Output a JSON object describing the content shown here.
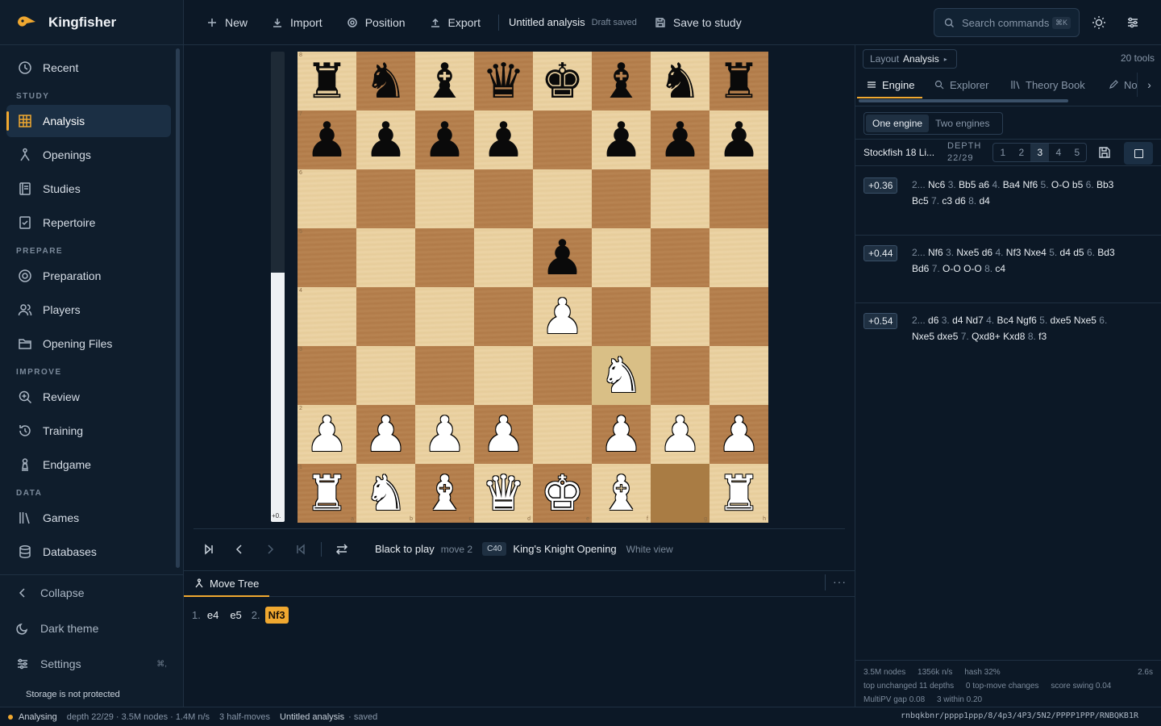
{
  "brand": {
    "name": "Kingfisher"
  },
  "sidebar": {
    "recent": {
      "label": "Recent",
      "icon": "clock-icon"
    },
    "sections": [
      {
        "title": "STUDY",
        "items": [
          {
            "label": "Analysis",
            "icon": "grid-icon",
            "active": true
          },
          {
            "label": "Openings",
            "icon": "branch-icon"
          },
          {
            "label": "Studies",
            "icon": "book-icon"
          },
          {
            "label": "Repertoire",
            "icon": "checklist-icon"
          }
        ]
      },
      {
        "title": "PREPARE",
        "items": [
          {
            "label": "Preparation",
            "icon": "target-icon"
          },
          {
            "label": "Players",
            "icon": "users-icon"
          },
          {
            "label": "Opening Files",
            "icon": "folder-icon"
          }
        ]
      },
      {
        "title": "IMPROVE",
        "items": [
          {
            "label": "Review",
            "icon": "zoom-icon"
          },
          {
            "label": "Training",
            "icon": "refresh-clock-icon"
          },
          {
            "label": "Endgame",
            "icon": "pawn-icon"
          }
        ]
      },
      {
        "title": "DATA",
        "items": [
          {
            "label": "Games",
            "icon": "library-icon"
          },
          {
            "label": "Databases",
            "icon": "database-icon"
          }
        ]
      }
    ],
    "collapse_label": "Collapse",
    "theme_label": "Dark theme",
    "settings_label": "Settings",
    "settings_kbd": "⌘,",
    "storage_note": "Storage is not protected"
  },
  "toolbar": {
    "new_label": "New",
    "import_label": "Import",
    "position_label": "Position",
    "export_label": "Export",
    "doc_title": "Untitled analysis",
    "draft_status": "Draft saved",
    "save_study_label": "Save to study",
    "search_placeholder": "Search commands",
    "search_kbd": "⌘K"
  },
  "eval_bar": {
    "white_fraction": 0.53,
    "label": "+0."
  },
  "board": {
    "orientation": "white",
    "fen": "rnbqkbnr/pppp1ppp/8/4p3/4P3/5N2/PPPP1PPP/RNBQKB1R",
    "highlight": [
      "g1",
      "f3"
    ],
    "ranks": [
      "8",
      "7",
      "6",
      "5",
      "4",
      "3",
      "2",
      "1"
    ],
    "files": [
      "a",
      "b",
      "c",
      "d",
      "e",
      "f",
      "g",
      "h"
    ]
  },
  "controls": {
    "to_play": "Black to play",
    "move": "move 2",
    "eco": "C40",
    "opening": "King's Knight Opening",
    "view": "White view"
  },
  "move_tree": {
    "tab_label": "Move Tree",
    "more": "···",
    "moves": [
      {
        "num": "1.",
        "white": "e4",
        "black": "e5"
      },
      {
        "num": "2.",
        "white": "Nf3",
        "current": "white"
      }
    ]
  },
  "right_panel": {
    "layout_prefix": "Layout",
    "layout_value": "Analysis",
    "tools_count": "20 tools",
    "tabs": [
      {
        "label": "Engine",
        "icon": "sliders-icon",
        "active": true
      },
      {
        "label": "Explorer",
        "icon": "search-icon"
      },
      {
        "label": "Theory Book",
        "icon": "library-icon"
      },
      {
        "label": "No",
        "icon": "pencil-icon"
      }
    ],
    "engine_modes": [
      "One engine",
      "Two engines"
    ],
    "engine_name": "Stockfish 18 Li...",
    "depth_label": "DEPTH",
    "depth_value": "22/29",
    "multipv": [
      "1",
      "2",
      "3",
      "4",
      "5"
    ],
    "multipv_selected": "3",
    "lines": [
      {
        "score": "+0.36",
        "text": [
          [
            "2...",
            "Nc6"
          ],
          [
            "3.",
            "Bb5"
          ],
          [
            "",
            "a6"
          ],
          [
            "4.",
            "Ba4"
          ],
          [
            "",
            "Nf6"
          ],
          [
            "5.",
            "O-O"
          ],
          [
            "",
            "b5"
          ],
          [
            "6.",
            "Bb3"
          ],
          [
            "",
            "Bc5"
          ],
          [
            "7.",
            "c3"
          ],
          [
            "",
            "d6"
          ],
          [
            "8.",
            "d4"
          ]
        ]
      },
      {
        "score": "+0.44",
        "text": [
          [
            "2...",
            "Nf6"
          ],
          [
            "3.",
            "Nxe5"
          ],
          [
            "",
            "d6"
          ],
          [
            "4.",
            "Nf3"
          ],
          [
            "",
            "Nxe4"
          ],
          [
            "5.",
            "d4"
          ],
          [
            "",
            "d5"
          ],
          [
            "6.",
            "Bd3"
          ],
          [
            "",
            "Bd6"
          ],
          [
            "7.",
            "O-O"
          ],
          [
            "",
            "O-O"
          ],
          [
            "8.",
            "c4"
          ]
        ]
      },
      {
        "score": "+0.54",
        "text": [
          [
            "2...",
            "d6"
          ],
          [
            "3.",
            "d4"
          ],
          [
            "",
            "Nd7"
          ],
          [
            "4.",
            "Bc4"
          ],
          [
            "",
            "Ngf6"
          ],
          [
            "5.",
            "dxe5"
          ],
          [
            "",
            "Nxe5"
          ],
          [
            "6.",
            "Nxe5"
          ],
          [
            "",
            "dxe5"
          ],
          [
            "7.",
            "Qxd8+"
          ],
          [
            "",
            "Kxd8"
          ],
          [
            "8.",
            "f3"
          ]
        ]
      }
    ],
    "stats": {
      "nodes": "3.5M nodes",
      "nps": "1356k n/s",
      "hash": "hash 32%",
      "time": "2.6s",
      "unchanged": "top unchanged 11 depths",
      "top_changes": "0 top-move changes",
      "swing": "score swing 0.04",
      "gap": "MultiPV gap 0.08",
      "within": "3 within 0.20"
    }
  },
  "statusbar": {
    "state": "Analysing",
    "depth_info": "depth 22/29 · 3.5M nodes · 1.4M n/s",
    "half_moves": "3 half-moves",
    "doc": "Untitled analysis",
    "doc_state": "· saved",
    "fen": "rnbqkbnr/pppp1ppp/8/4p3/4P3/5N2/PPPP1PPP/RNBQKB1R"
  },
  "colors": {
    "accent": "#f0a830",
    "background": "#0c1826",
    "panel": "#0f1d2c"
  }
}
